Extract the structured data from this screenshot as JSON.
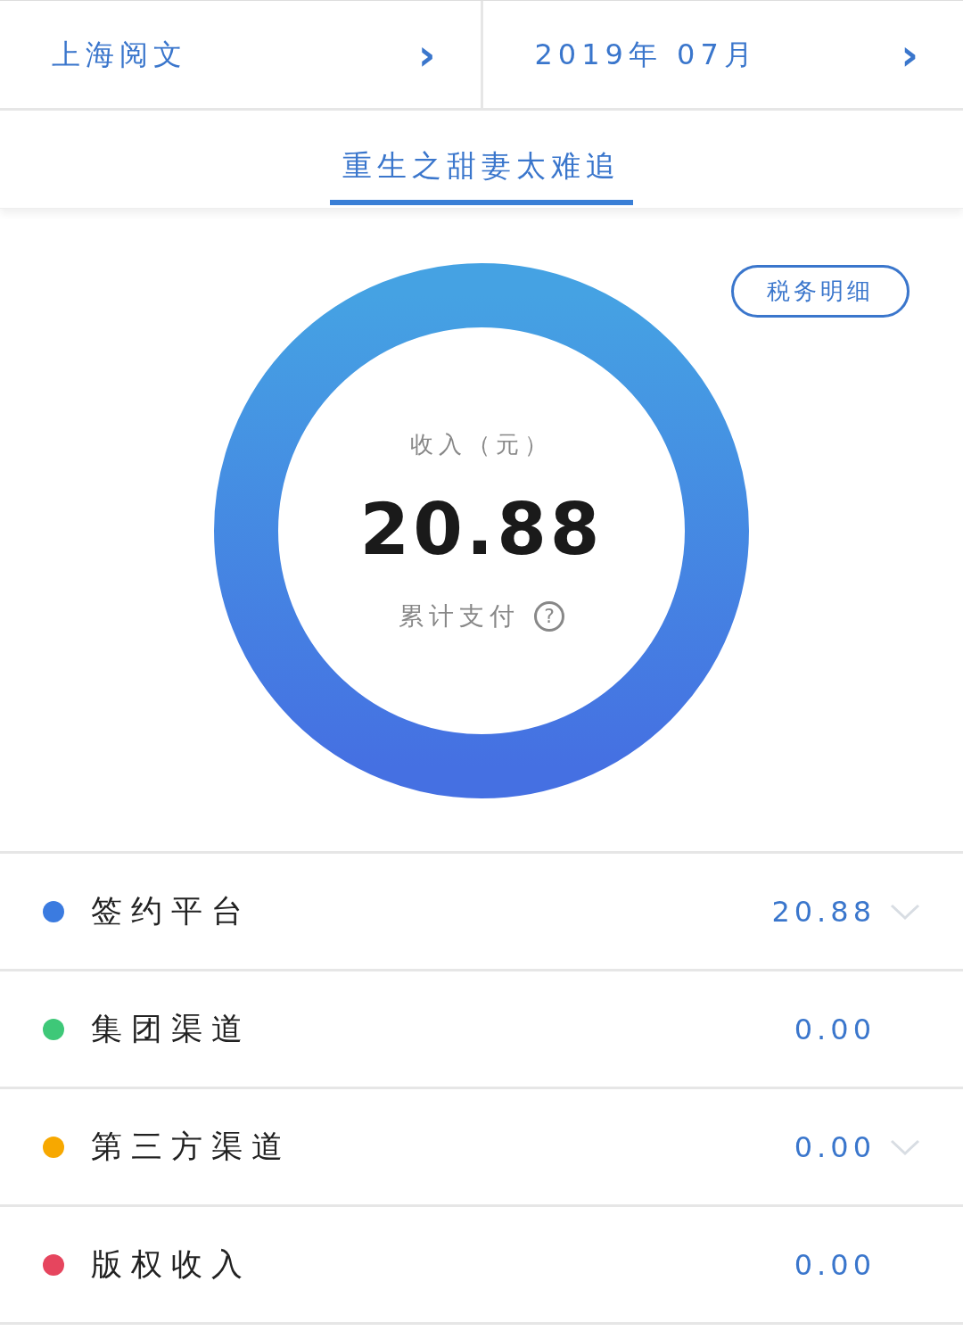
{
  "selectors": [
    {
      "label": "上海阅文",
      "chevron": "›"
    },
    {
      "label": "2019年 07月",
      "chevron": "›"
    }
  ],
  "tabs": [
    {
      "label": "重生之甜妻太难追",
      "selected": true
    }
  ],
  "tax_button": "税务明细",
  "summary": {
    "caption": "收入（元）",
    "amount": "20.88",
    "note": "累计支付",
    "help": "?"
  },
  "channels": [
    {
      "name": "签约平台",
      "amount": "20.88",
      "color": "#3b7be0",
      "kind": "expandable"
    },
    {
      "name": "集团渠道",
      "amount": "0.00",
      "color": "#3ec878",
      "kind": "plain"
    },
    {
      "name": "第三方渠道",
      "amount": "0.00",
      "color": "#f7a800",
      "kind": "expandable"
    },
    {
      "name": "版权收入",
      "amount": "0.00",
      "color": "#e6455e",
      "kind": "plain"
    }
  ]
}
